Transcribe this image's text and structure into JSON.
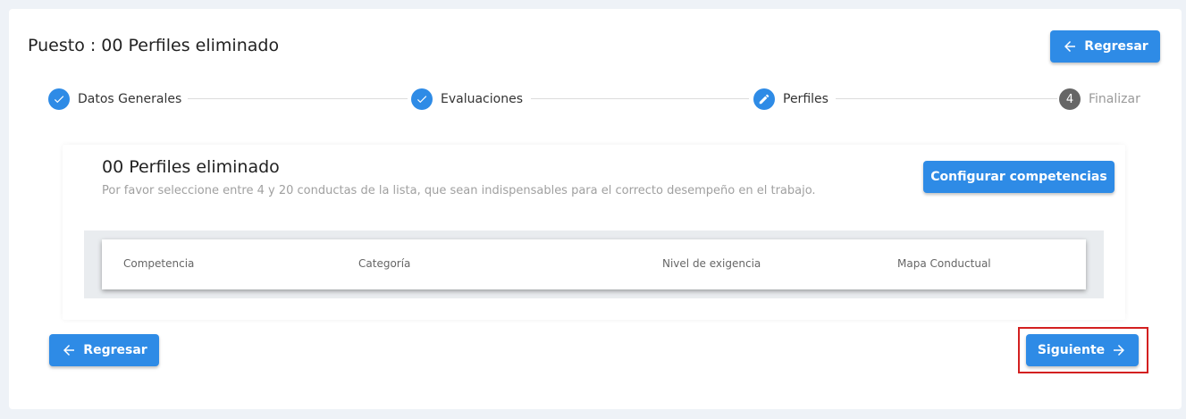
{
  "header": {
    "title": "Puesto : 00 Perfiles eliminado",
    "back_label": "Regresar"
  },
  "stepper": {
    "steps": [
      {
        "label": "Datos Generales",
        "state": "done"
      },
      {
        "label": "Evaluaciones",
        "state": "done"
      },
      {
        "label": "Perfiles",
        "state": "editing"
      },
      {
        "label": "Finalizar",
        "state": "pending",
        "number": "4"
      }
    ]
  },
  "panel": {
    "title": "00 Perfiles eliminado",
    "description": "Por favor seleccione entre 4 y 20 conductas de la lista, que sean indispensables para el correcto desempeño en el trabajo.",
    "config_button": "Configurar competencias",
    "table": {
      "columns": [
        "Competencia",
        "Categoría",
        "Nivel de exigencia",
        "Mapa Conductual"
      ]
    }
  },
  "footer": {
    "back_label": "Regresar",
    "next_label": "Siguiente"
  },
  "colors": {
    "accent": "#2e8be6",
    "highlight": "#d32020"
  }
}
